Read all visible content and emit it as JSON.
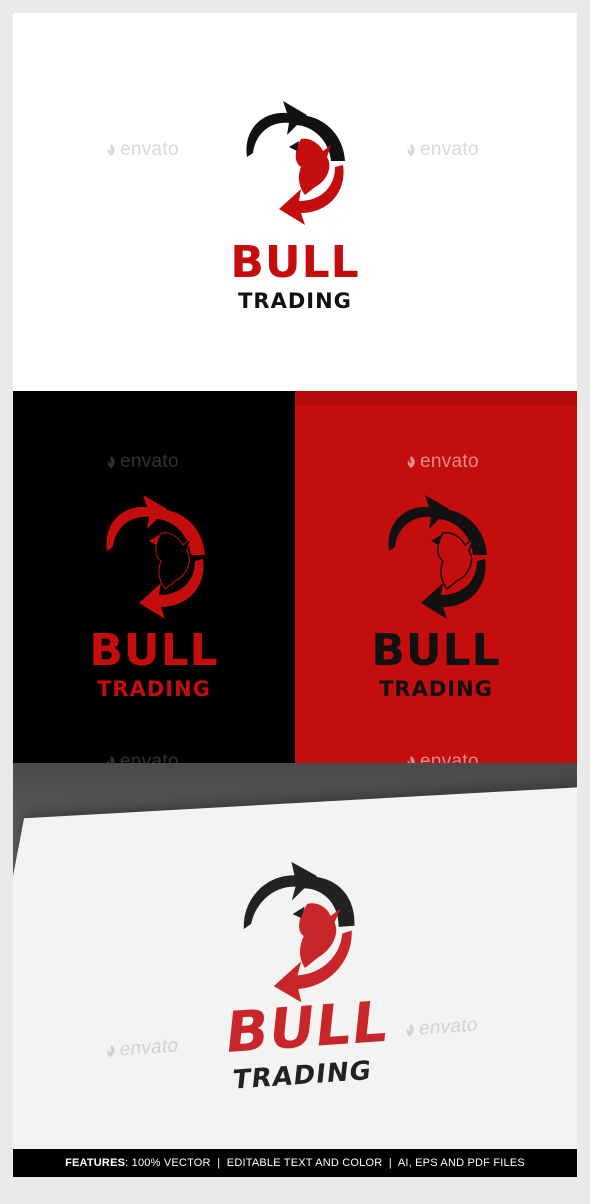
{
  "watermark": "envato",
  "logo": {
    "word1": "BULL",
    "word2": "TRADING"
  },
  "footer": {
    "features_label": "FEATURES",
    "features_text": ": 100% VECTOR  |  EDITABLE TEXT AND COLOR  |  AI, EPS AND PDF FILES"
  },
  "colors": {
    "brand_red": "#c40d0d",
    "black": "#111111",
    "white": "#ffffff"
  },
  "icons": [
    "bull-arrow-logo-icon",
    "envato-leaf-icon"
  ]
}
